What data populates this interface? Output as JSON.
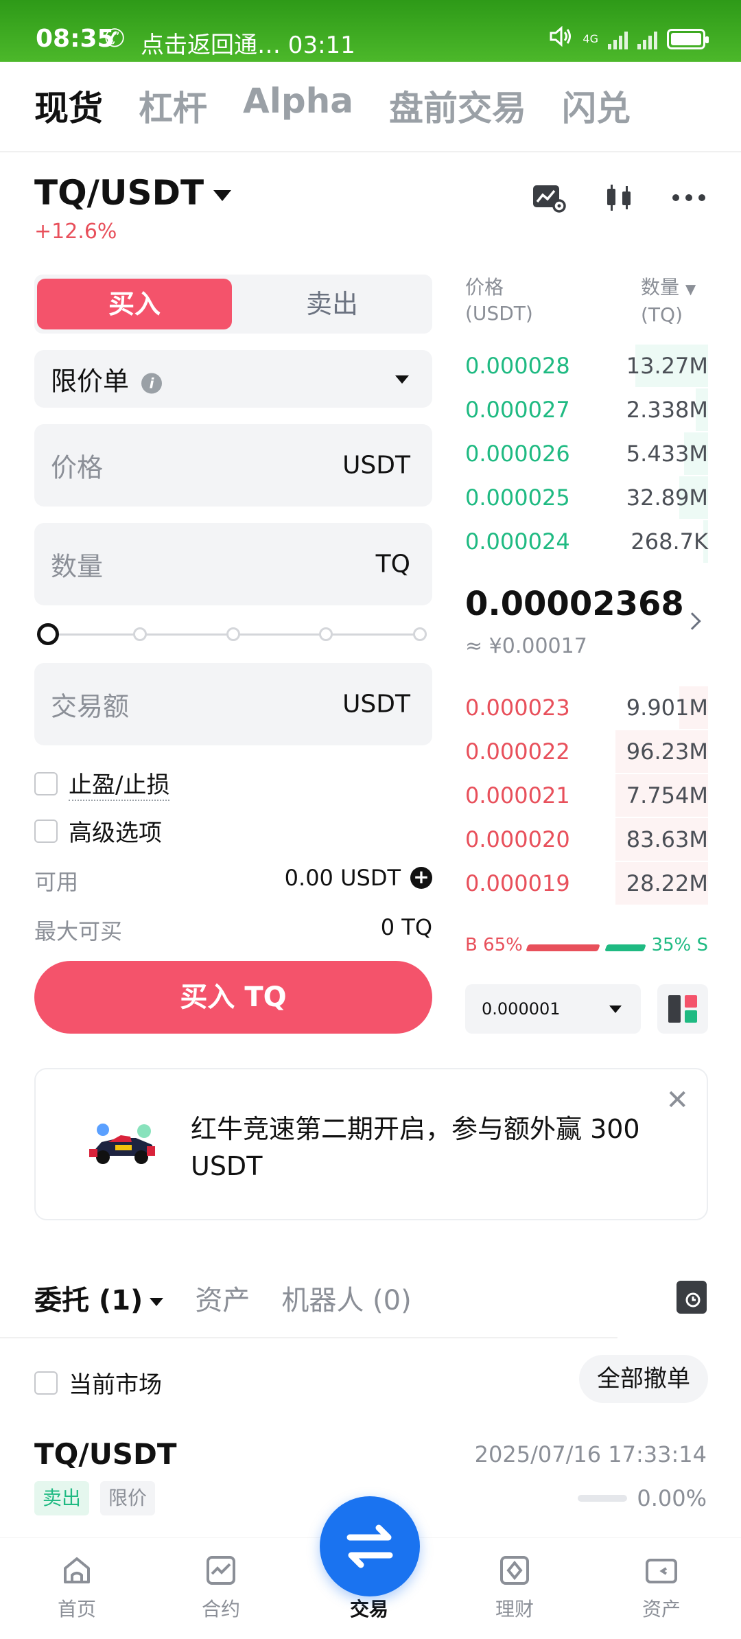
{
  "status_bar": {
    "time": "08:35",
    "call_text": "点击返回通… 03:11",
    "network": "4G"
  },
  "top_tabs": [
    {
      "label": "现货",
      "active": true
    },
    {
      "label": "杠杆",
      "active": false
    },
    {
      "label": "Alpha",
      "active": false
    },
    {
      "label": "盘前交易",
      "active": false
    },
    {
      "label": "闪兑",
      "active": false
    }
  ],
  "pair": {
    "symbol": "TQ/USDT",
    "change": "+12.6%"
  },
  "header_icons": [
    "chart-settings-icon",
    "candlestick-icon",
    "more-icon"
  ],
  "order_form": {
    "buy_tab": "买入",
    "sell_tab": "卖出",
    "order_type": "限价单",
    "price_label": "价格",
    "price_unit": "USDT",
    "amount_label": "数量",
    "amount_unit": "TQ",
    "slider_percent": 0,
    "total_label": "交易额",
    "total_unit": "USDT",
    "tpsl_label": "止盈/止损",
    "advanced_label": "高级选项",
    "available_label": "可用",
    "available_value": "0.00 USDT",
    "max_buy_label": "最大可买",
    "max_buy_value": "0 TQ",
    "submit_label": "买入 TQ"
  },
  "order_book": {
    "price_header": "价格",
    "price_unit": "(USDT)",
    "qty_header": "数量",
    "qty_unit": "(TQ)",
    "asks": [
      {
        "price": "0.000028",
        "qty": "13.27M",
        "depth": 0.3
      },
      {
        "price": "0.000027",
        "qty": "2.338M",
        "depth": 0.05
      },
      {
        "price": "0.000026",
        "qty": "5.433M",
        "depth": 0.1
      },
      {
        "price": "0.000025",
        "qty": "32.89M",
        "depth": 0.12
      },
      {
        "price": "0.000024",
        "qty": "268.7K",
        "depth": 0.02
      }
    ],
    "last_price": "0.00002368",
    "last_price_cny": "≈ ¥0.00017",
    "bids": [
      {
        "price": "0.000023",
        "qty": "9.901M",
        "depth": 0.12
      },
      {
        "price": "0.000022",
        "qty": "96.23M",
        "depth": 0.38
      },
      {
        "price": "0.000021",
        "qty": "7.754M",
        "depth": 0.38
      },
      {
        "price": "0.000020",
        "qty": "83.63M",
        "depth": 0.38
      },
      {
        "price": "0.000019",
        "qty": "28.22M",
        "depth": 0.38
      }
    ],
    "buy_ratio": "B 65%",
    "sell_ratio": "35% S",
    "buy_ratio_value": 0.65,
    "precision": "0.000001"
  },
  "banner": {
    "text": "红牛竞速第二期开启，参与额外赢 300 USDT"
  },
  "orders": {
    "tabs": [
      {
        "label": "委托 (1)",
        "active": true
      },
      {
        "label": "资产",
        "active": false
      },
      {
        "label": "机器人 (0)",
        "active": false
      }
    ],
    "current_market_label": "当前市场",
    "cancel_all_label": "全部撤单",
    "items": [
      {
        "pair": "TQ/USDT",
        "time": "2025/07/16 17:33:14",
        "side": "卖出",
        "type": "限价",
        "filled": "0.00%"
      }
    ]
  },
  "bottom_nav": [
    {
      "label": "首页",
      "icon": "home-icon",
      "active": false
    },
    {
      "label": "合约",
      "icon": "futures-icon",
      "active": false
    },
    {
      "label": "交易",
      "icon": "swap-icon",
      "active": true
    },
    {
      "label": "理财",
      "icon": "earn-icon",
      "active": false
    },
    {
      "label": "资产",
      "icon": "wallet-icon",
      "active": false
    }
  ],
  "colors": {
    "buy": "#f4536b",
    "sell": "#1fba82",
    "fab": "#1a73f0",
    "status_bar": "#3aa820"
  }
}
